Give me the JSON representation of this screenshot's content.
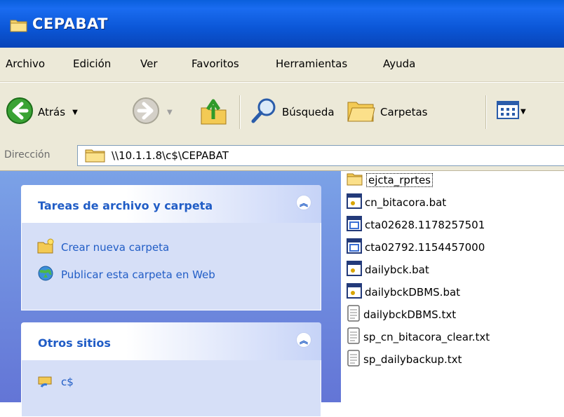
{
  "window": {
    "title": "CEPABAT"
  },
  "menu": [
    "Archivo",
    "Edición",
    "Ver",
    "Favoritos",
    "Herramientas",
    "Ayuda"
  ],
  "toolbar": {
    "back_label": "Atrás",
    "search_label": "Búsqueda",
    "folders_label": "Carpetas"
  },
  "address": {
    "label": "Dirección",
    "path": "\\\\10.1.1.8\\c$\\CEPABAT"
  },
  "taskpane": {
    "file_tasks": {
      "title": "Tareas de archivo y carpeta",
      "items": [
        "Crear nueva carpeta",
        "Publicar esta carpeta en Web"
      ]
    },
    "other_places": {
      "title": "Otros sitios",
      "items": [
        "c$"
      ]
    }
  },
  "files": [
    {
      "name": "ejcta_rprtes",
      "type": "folder"
    },
    {
      "name": "cn_bitacora.bat",
      "type": "bat"
    },
    {
      "name": "cta02628.1178257501",
      "type": "generic"
    },
    {
      "name": "cta02792.1154457000",
      "type": "generic"
    },
    {
      "name": "dailybck.bat",
      "type": "bat"
    },
    {
      "name": "dailybckDBMS.bat",
      "type": "bat"
    },
    {
      "name": "dailybckDBMS.txt",
      "type": "txt"
    },
    {
      "name": "sp_cn_bitacora_clear.txt",
      "type": "txt"
    },
    {
      "name": "sp_dailybackup.txt",
      "type": "txt"
    }
  ]
}
